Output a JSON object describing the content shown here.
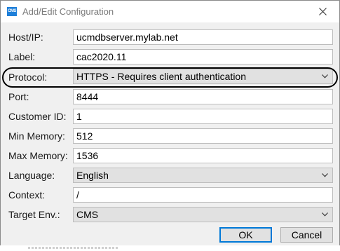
{
  "window": {
    "title": "Add/Edit Configuration",
    "icon_text": "CMS"
  },
  "fields": {
    "host": {
      "label": "Host/IP:",
      "value": "ucmdbserver.mylab.net"
    },
    "label": {
      "label": "Label:",
      "value": "cac2020.11"
    },
    "protocol": {
      "label": "Protocol:",
      "value": "HTTPS - Requires client authentication"
    },
    "port": {
      "label": "Port:",
      "value": "8444"
    },
    "customer_id": {
      "label": "Customer ID:",
      "value": "1"
    },
    "min_memory": {
      "label": "Min Memory:",
      "value": "512"
    },
    "max_memory": {
      "label": "Max Memory:",
      "value": "1536"
    },
    "language": {
      "label": "Language:",
      "value": "English"
    },
    "context": {
      "label": "Context:",
      "value": "/"
    },
    "target_env": {
      "label": "Target Env.:",
      "value": "CMS"
    }
  },
  "buttons": {
    "ok": "OK",
    "cancel": "Cancel"
  },
  "icons": {
    "close": "close-icon",
    "dropdown": "chevron-down-icon",
    "app": "cms-app-icon"
  },
  "colors": {
    "accent": "#0078d7",
    "app_icon": "#1e7fd9",
    "annotation": "#000000"
  }
}
